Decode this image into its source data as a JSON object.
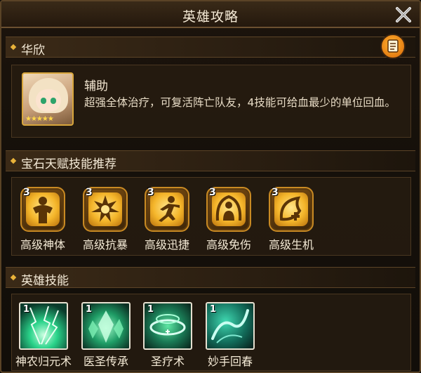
{
  "window": {
    "title": "英雄攻略"
  },
  "hero": {
    "name": "华欣",
    "role": "辅助",
    "description": "超强全体治疗，可复活阵亡队友，4技能可给血最少的单位回血。",
    "stars": "★★★★★"
  },
  "gems": {
    "header": "宝石天赋技能推荐",
    "items": [
      {
        "level": "3",
        "label": "高级神体",
        "icon": "muscle-man-icon"
      },
      {
        "level": "3",
        "label": "高级抗暴",
        "icon": "burst-shield-icon"
      },
      {
        "level": "3",
        "label": "高级迅捷",
        "icon": "running-figure-icon"
      },
      {
        "level": "3",
        "label": "高级免伤",
        "icon": "shielded-figure-icon"
      },
      {
        "level": "3",
        "label": "高级生机",
        "icon": "leaf-cross-icon"
      }
    ]
  },
  "skills": {
    "header": "英雄技能",
    "items": [
      {
        "level": "1",
        "label": "神农归元术",
        "icon": "green-lightning-icon"
      },
      {
        "level": "1",
        "label": "医圣传承",
        "icon": "spirit-crystal-icon"
      },
      {
        "level": "1",
        "label": "圣疗术",
        "icon": "healing-ring-icon"
      },
      {
        "level": "1",
        "label": "妙手回春",
        "icon": "water-dragon-icon"
      }
    ]
  },
  "colors": {
    "gold": "#e9b33a",
    "frame": "#5a4326",
    "text": "#f0e6d2"
  }
}
